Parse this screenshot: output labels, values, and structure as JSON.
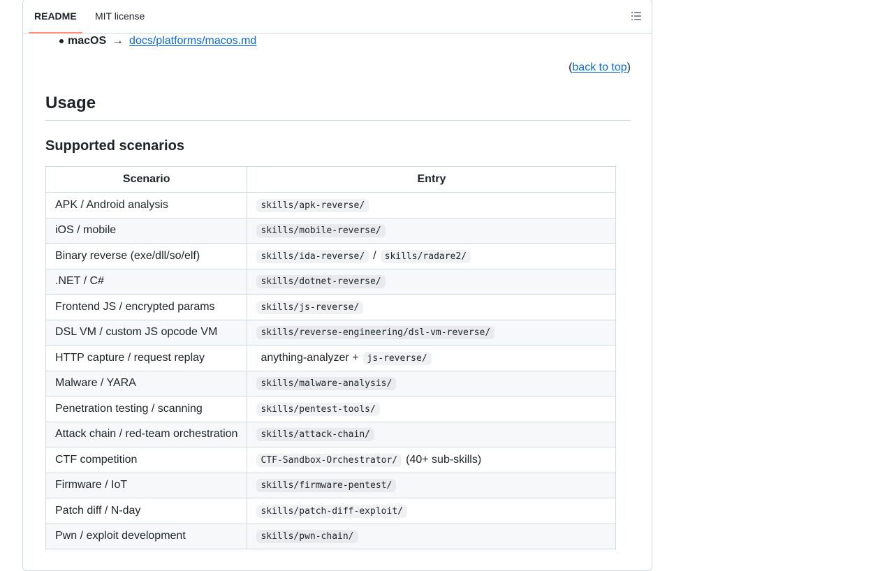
{
  "tabs": [
    {
      "label": "README",
      "active": true
    },
    {
      "label": "MIT license",
      "active": false
    }
  ],
  "outline_icon": "list-unordered-icon",
  "bullet": {
    "label": "macOS",
    "arrow": "→",
    "link": "docs/platforms/macos.md"
  },
  "back_to_top": {
    "open": "(",
    "link": "back to top",
    "close": ")"
  },
  "usage_heading": "Usage",
  "scenarios_heading": "Supported scenarios",
  "table": {
    "headers": [
      "Scenario",
      "Entry"
    ],
    "rows": [
      {
        "scenario": "APK / Android analysis",
        "entry": [
          {
            "code": "skills/apk-reverse/"
          }
        ]
      },
      {
        "scenario": "iOS / mobile",
        "entry": [
          {
            "code": "skills/mobile-reverse/"
          }
        ]
      },
      {
        "scenario": "Binary reverse (exe/dll/so/elf)",
        "entry": [
          {
            "code": "skills/ida-reverse/"
          },
          {
            "text": "/"
          },
          {
            "code": "skills/radare2/"
          }
        ]
      },
      {
        "scenario": ".NET / C#",
        "entry": [
          {
            "code": "skills/dotnet-reverse/"
          }
        ]
      },
      {
        "scenario": "Frontend JS / encrypted params",
        "entry": [
          {
            "code": "skills/js-reverse/"
          }
        ]
      },
      {
        "scenario": "DSL VM / custom JS opcode VM",
        "entry": [
          {
            "code": "skills/reverse-engineering/dsl-vm-reverse/"
          }
        ]
      },
      {
        "scenario": "HTTP capture / request replay",
        "entry": [
          {
            "text": "anything-analyzer +"
          },
          {
            "code": "js-reverse/"
          }
        ]
      },
      {
        "scenario": "Malware / YARA",
        "entry": [
          {
            "code": "skills/malware-analysis/"
          }
        ]
      },
      {
        "scenario": "Penetration testing / scanning",
        "entry": [
          {
            "code": "skills/pentest-tools/"
          }
        ]
      },
      {
        "scenario": "Attack chain / red-team orchestration",
        "entry": [
          {
            "code": "skills/attack-chain/"
          }
        ]
      },
      {
        "scenario": "CTF competition",
        "entry": [
          {
            "code": "CTF-Sandbox-Orchestrator/"
          },
          {
            "text": "(40+ sub-skills)"
          }
        ]
      },
      {
        "scenario": "Firmware / IoT",
        "entry": [
          {
            "code": "skills/firmware-pentest/"
          }
        ]
      },
      {
        "scenario": "Patch diff / N-day",
        "entry": [
          {
            "code": "skills/patch-diff-exploit/"
          }
        ]
      },
      {
        "scenario": "Pwn / exploit development",
        "entry": [
          {
            "code": "skills/pwn-chain/"
          }
        ]
      }
    ]
  }
}
